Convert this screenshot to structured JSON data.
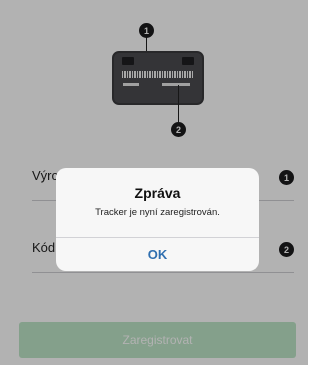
{
  "illustration": {
    "callout_top_number": "1",
    "callout_bottom_number": "2"
  },
  "form": {
    "fields": [
      {
        "label_partial": "Výrc",
        "badge": "1"
      },
      {
        "label_partial": "Kód",
        "badge": "2"
      }
    ],
    "register_label": "Zaregistrovat"
  },
  "dialog": {
    "title": "Zpráva",
    "message": "Tracker je nyní zaregistrován.",
    "ok_label": "OK"
  },
  "colors": {
    "register_button": "#bde6c7",
    "dialog_button_text": "#2f6fb0"
  }
}
